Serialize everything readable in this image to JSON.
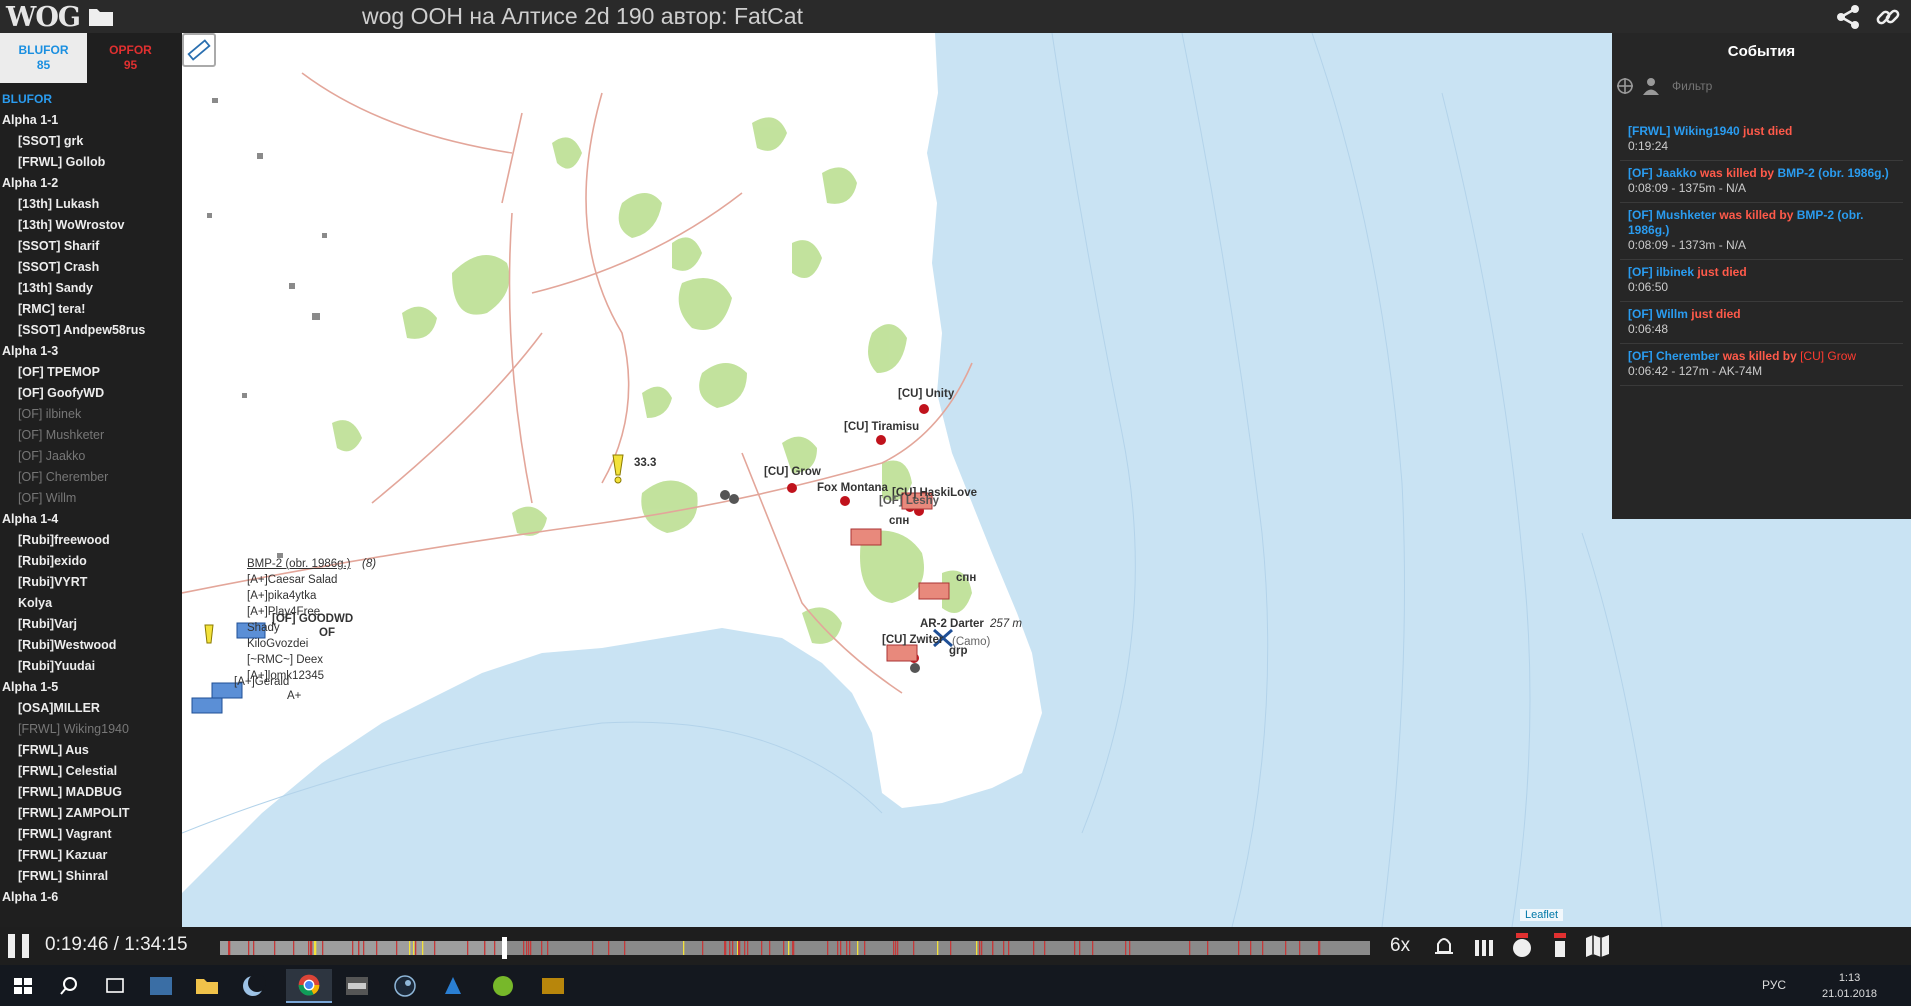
{
  "app": {
    "logo": "WOG",
    "title": "wog OOH на Алтисе 2d 190 автор: FatCat"
  },
  "sides": {
    "blufor": {
      "label": "BLUFOR",
      "count": "85"
    },
    "opfor": {
      "label": "OPFOR",
      "count": "95"
    }
  },
  "unit_list": {
    "side_heading": "BLUFOR",
    "groups": [
      {
        "name": "Alpha 1-1",
        "units": [
          {
            "name": "[SSOT] grk",
            "dead": false
          },
          {
            "name": "[FRWL] Gollob",
            "dead": false
          }
        ]
      },
      {
        "name": "Alpha 1-2",
        "units": [
          {
            "name": "[13th] Lukash",
            "dead": false
          },
          {
            "name": "[13th] WoWrostov",
            "dead": false
          },
          {
            "name": "[SSOT] Sharif",
            "dead": false
          },
          {
            "name": "[SSOT] Crash",
            "dead": false
          },
          {
            "name": "[13th] Sandy",
            "dead": false
          },
          {
            "name": "[RMC] tera!",
            "dead": false
          },
          {
            "name": "[SSOT] Andpew58rus",
            "dead": false
          }
        ]
      },
      {
        "name": "Alpha 1-3",
        "units": [
          {
            "name": "[OF] TPEMOP",
            "dead": false
          },
          {
            "name": "[OF] GoofyWD",
            "dead": false
          },
          {
            "name": "[OF] ilbinek",
            "dead": true
          },
          {
            "name": "[OF] Mushketer",
            "dead": true
          },
          {
            "name": "[OF] Jaakko",
            "dead": true
          },
          {
            "name": "[OF] Cherember",
            "dead": true
          },
          {
            "name": "[OF] Willm",
            "dead": true
          }
        ]
      },
      {
        "name": "Alpha 1-4",
        "units": [
          {
            "name": "[Rubi]freewood",
            "dead": false
          },
          {
            "name": "[Rubi]exido",
            "dead": false
          },
          {
            "name": "[Rubi]VYRT",
            "dead": false
          },
          {
            "name": "Kolya",
            "dead": false
          },
          {
            "name": "[Rubi]Varj",
            "dead": false
          },
          {
            "name": "[Rubi]Westwood",
            "dead": false
          },
          {
            "name": "[Rubi]Yuudai",
            "dead": false
          }
        ]
      },
      {
        "name": "Alpha 1-5",
        "units": [
          {
            "name": "[OSA]MILLER",
            "dead": false
          },
          {
            "name": "[FRWL] Wiking1940",
            "dead": true
          },
          {
            "name": "[FRWL] Aus",
            "dead": false
          },
          {
            "name": "[FRWL] Celestial",
            "dead": false
          },
          {
            "name": "[FRWL] MADBUG",
            "dead": false
          },
          {
            "name": "[FRWL] ZAMPOLIT",
            "dead": false
          },
          {
            "name": "[FRWL] Vagrant",
            "dead": false
          },
          {
            "name": "[FRWL] Kazuar",
            "dead": false
          },
          {
            "name": "[FRWL] Shinral",
            "dead": false
          }
        ]
      },
      {
        "name": "Alpha 1-6",
        "units": []
      }
    ]
  },
  "map": {
    "attribution": "Leaflet",
    "labels": {
      "unity": "[CU] Unity",
      "tiramisu": "[CU] Tiramisu",
      "grow": "[CU] Grow",
      "fox": "Fox Montana",
      "haskilove": "[CU] HaskiLove",
      "leshy": "[OF] Leshy",
      "marker_num": "33.3",
      "spn1": "спн",
      "spn2": "спн",
      "darter": "AR-2 Darter",
      "darter_dist": "257 m",
      "zwiter": "[CU] Zwiter",
      "camo": "(Camo)",
      "grp": "grp",
      "bmp": "BMP-2 (obr. 1986g.)",
      "bmp_count": "(8)",
      "caesar": "[A+]Caesar Salad",
      "pika": "[A+]pika4ytka",
      "play": "[A+]Play4Free",
      "shady": "Shady",
      "goodwd": "[OF] GOODWD",
      "of": "OF",
      "kilo": "KiloGvozdei",
      "deex": "[~RMC~] Deex",
      "lomk": "[A+]lomk12345",
      "gerald": "[A+]Gerald",
      "aplus": "A+"
    }
  },
  "events": {
    "title": "События",
    "filter_placeholder": "Фильтр",
    "items": [
      {
        "victim": "[FRWL] Wiking1940",
        "action": "just died",
        "killer": "",
        "time": "0:19:24"
      },
      {
        "victim": "[OF] Jaakko",
        "action": "was killed by",
        "killer": "BMP-2 (obr. 1986g.)",
        "killer_side": "blu",
        "time": "0:08:09 - 1375m - N/A"
      },
      {
        "victim": "[OF] Mushketer",
        "action": "was killed by",
        "killer": "BMP-2 (obr. 1986g.)",
        "killer_side": "blu",
        "time": "0:08:09 - 1373m - N/A"
      },
      {
        "victim": "[OF] ilbinek",
        "action": "just died",
        "killer": "",
        "time": "0:06:50"
      },
      {
        "victim": "[OF] Willm",
        "action": "just died",
        "killer": "",
        "time": "0:06:48"
      },
      {
        "victim": "[OF] Cherember",
        "action": "was killed by",
        "killer": "[CU] Grow",
        "killer_side": "red",
        "time": "0:06:42 - 127m - AK-74M"
      }
    ]
  },
  "playback": {
    "time": "0:19:46 / 1:34:15",
    "progress": 0.2467,
    "speed": "6x"
  },
  "taskbar": {
    "lang": "РУС",
    "clock": "1:13",
    "date": "21.01.2018"
  },
  "colors": {
    "blufor": "#2a9cf0",
    "opfor": "#e03030",
    "sea": "#c9e3f3",
    "land": "#ffffff",
    "forest": "#b9dc8f"
  }
}
